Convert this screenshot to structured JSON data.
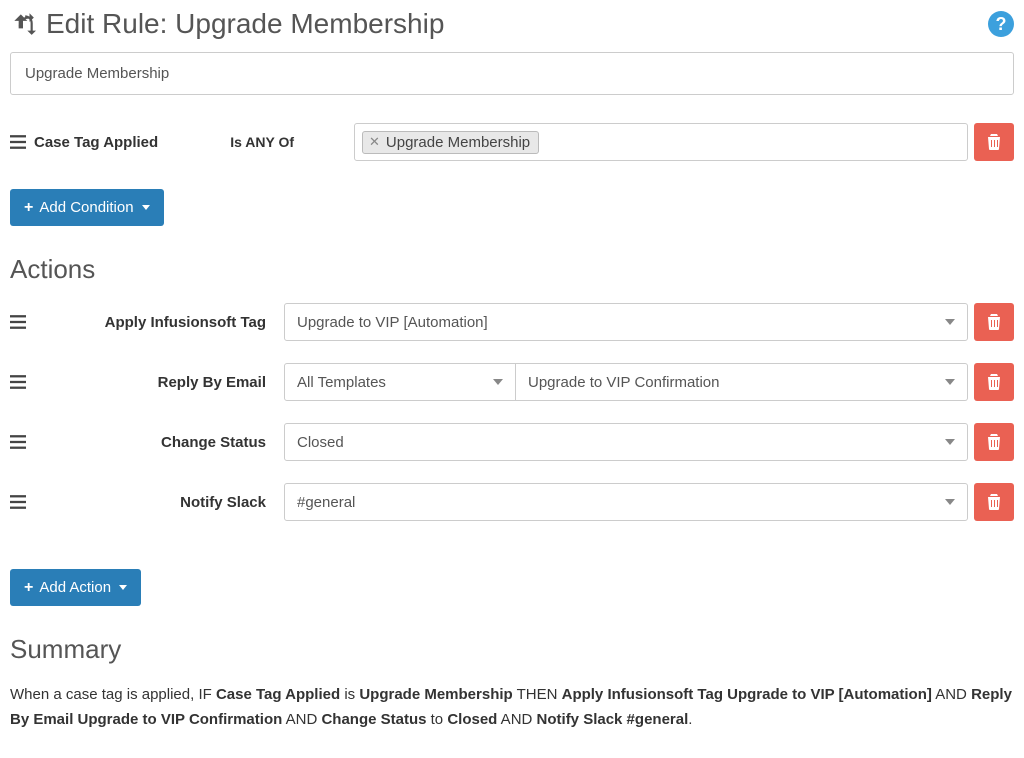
{
  "header": {
    "title": "Edit Rule: Upgrade Membership"
  },
  "ruleName": "Upgrade Membership",
  "condition": {
    "field": "Case Tag Applied",
    "operator": "Is ANY Of",
    "tag": "Upgrade Membership"
  },
  "buttons": {
    "addCondition": "Add Condition",
    "addAction": "Add Action"
  },
  "sections": {
    "actions": "Actions",
    "summary": "Summary"
  },
  "actions": [
    {
      "label": "Apply Infusionsoft Tag",
      "value": "Upgrade to VIP [Automation]"
    },
    {
      "label": "Reply By Email",
      "subSelect": "All Templates",
      "value": "Upgrade to VIP Confirmation"
    },
    {
      "label": "Change Status",
      "value": "Closed"
    },
    {
      "label": "Notify Slack",
      "value": "#general"
    }
  ],
  "summary": {
    "pre": "When a case tag is applied, IF ",
    "p1": "Case Tag Applied",
    "p2": " is ",
    "p3": "Upgrade Membership",
    "p4": " THEN ",
    "p5": "Apply Infusionsoft Tag Upgrade to VIP [Automation]",
    "p6": " AND ",
    "p7": "Reply By Email Upgrade to VIP Confirmation",
    "p8": " AND ",
    "p9": "Change Status",
    "p10": " to ",
    "p11": "Closed",
    "p12": " AND ",
    "p13": "Notify Slack #general",
    "p14": "."
  }
}
